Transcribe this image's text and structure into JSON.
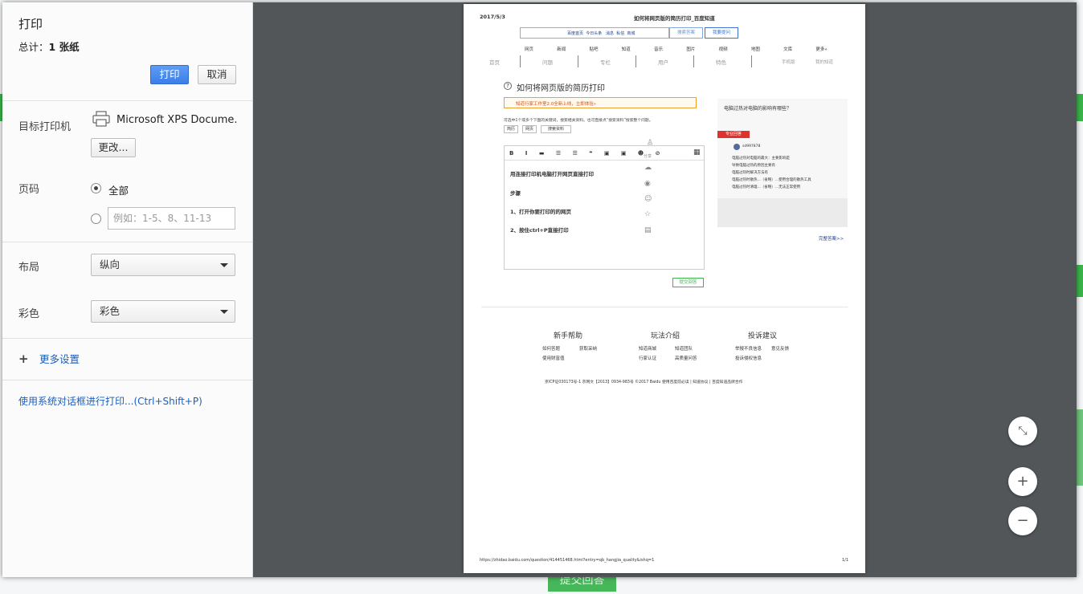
{
  "dialog": {
    "title": "打印",
    "total_prefix": "总计：",
    "total_value": "1 张纸",
    "print_label": "打印",
    "cancel_label": "取消",
    "destination_label": "目标打印机",
    "printer_name": "Microsoft XPS Docume...",
    "change_label": "更改...",
    "pages_label": "页码",
    "pages_all": "全部",
    "pages_custom_placeholder": "例如：1-5、8、11-13",
    "layout_label": "布局",
    "layout_value": "纵向",
    "color_label": "彩色",
    "color_value": "彩色",
    "more_settings": "更多设置",
    "system_dialog": "使用系统对话框进行打印...(Ctrl+Shift+P)"
  },
  "preview": {
    "date": "2017/5/3",
    "page_title": "如何将网页版的简历打印_百度知道",
    "top_links": [
      "百度首页",
      "今日头条",
      "消息",
      "私信",
      "商城"
    ],
    "search_btn1": "搜索答案",
    "search_btn2": "我要提问",
    "nav_items": [
      "网页",
      "新闻",
      "贴吧",
      "知道",
      "音乐",
      "图片",
      "视频",
      "地图",
      "文库",
      "更多»"
    ],
    "tabs": [
      "首页",
      "问题",
      "专栏",
      "用户",
      "特色",
      "手机版",
      "我的知道"
    ],
    "question_title": "如何将网页版的简历打印",
    "notice": "知道行家工作室2.0全新上线，立即体验»",
    "hint": "可选中1个或多个下面的关键词，搜索相关资料。也可直接点“搜索资料”搜索整个问题。",
    "keywords": [
      "简历",
      "网页",
      "搜索资料"
    ],
    "editor_lines": [
      "用连接打印机电脑打开网页直接打印",
      "步骤",
      "1、打开你要打印的的网页",
      "2、按住ctrl+P直接打印"
    ],
    "share_label": "分享",
    "submit_label": "提交回答",
    "related_title": "电脑过热对电脑的影响有哪些？",
    "related_badge": "专业回答",
    "related_user": "sd997878",
    "related_lines": [
      "电脑过热对电脑的最大：主要影响是",
      "导致电脑过热的原因主要有",
      "电脑过热时解决方法有",
      "电脑过热时散热...（省略）...使用合理的散热工具",
      "电脑过热时清理...（省略）...无法正常使用"
    ],
    "full_answer": "完整答案>>",
    "footer_cols": [
      {
        "title": "新手帮助",
        "links": [
          "如何答题",
          "获取采纳",
          "使用财富值"
        ]
      },
      {
        "title": "玩法介绍",
        "links": [
          "知道商城",
          "知道团队",
          "行家认证",
          "高质量问答"
        ]
      },
      {
        "title": "投诉建议",
        "links": [
          "举报不良信息",
          "意见反馈",
          "投诉侵权信息"
        ]
      }
    ],
    "copyright": "京ICP证030173号-1   京网文【2013】0934-983号     ©2017 Baidu   使用百度前必读 | 知道协议 | 百度知道品牌合作",
    "url": "https://zhidao.baidu.com/question/414451468.html?entry=qb_hangjia_quality&ishq=1",
    "page_num": "1/1"
  },
  "background": {
    "submit_label": "提交回答"
  },
  "colors": {
    "print_button": "#3b7fe8",
    "preview_bg": "#525659",
    "link_blue": "#1a5fbf",
    "baidu_green": "#3bb54a"
  }
}
